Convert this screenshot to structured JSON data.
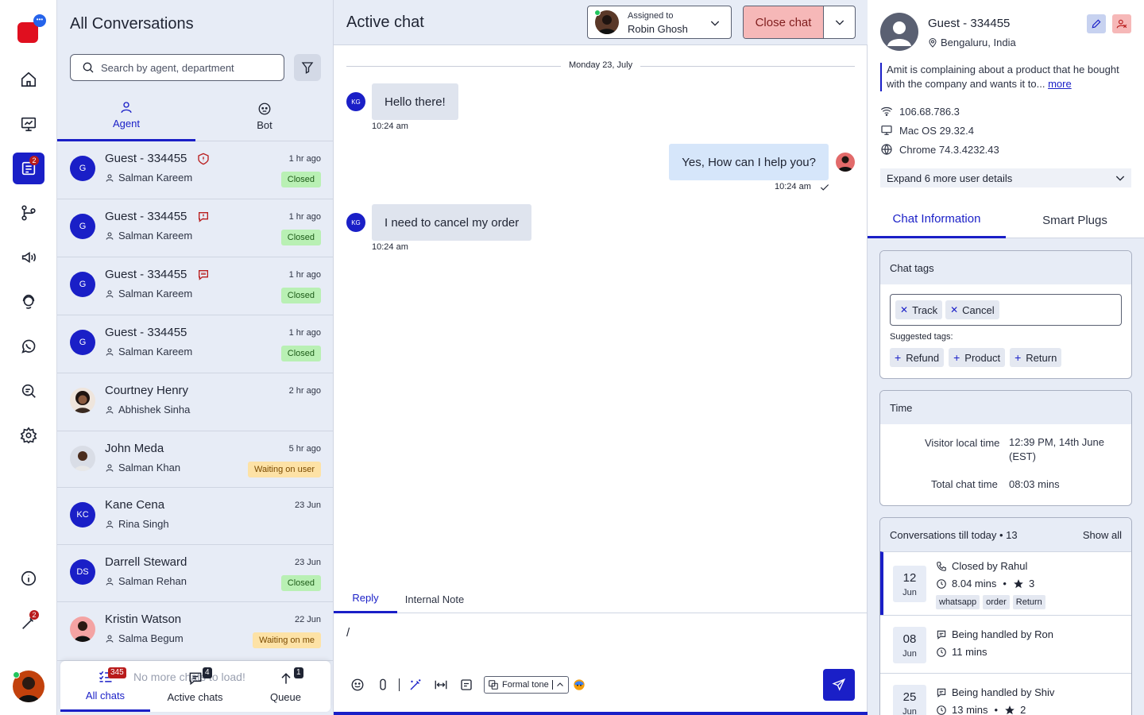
{
  "colors": {
    "accent": "#1a1fc7",
    "closed_bg": "#b9f0b4",
    "waiting_bg": "#fde2a6",
    "danger_bg": "#f6b8b8"
  },
  "rail": {
    "inbox_badge": "2",
    "magic_badge": "2"
  },
  "list": {
    "title": "All Conversations",
    "search_placeholder": "Search by agent, department",
    "tabs": [
      {
        "label": "Agent"
      },
      {
        "label": "Bot"
      }
    ],
    "items": [
      {
        "initials": "G",
        "name": "Guest - 334455",
        "agent": "Salman Kareem",
        "time": "1 hr ago",
        "status": "Closed"
      },
      {
        "initials": "G",
        "name": "Guest - 334455",
        "agent": "Salman Kareem",
        "time": "1 hr ago",
        "status": "Closed"
      },
      {
        "initials": "G",
        "name": "Guest - 334455",
        "agent": "Salman Kareem",
        "time": "1 hr ago",
        "status": "Closed"
      },
      {
        "initials": "G",
        "name": "Guest - 334455",
        "agent": "Salman Kareem",
        "time": "1 hr ago",
        "status": "Closed"
      },
      {
        "initials": "",
        "name": "Courtney Henry",
        "agent": "Abhishek Sinha",
        "time": "2 hr ago",
        "status": ""
      },
      {
        "initials": "",
        "name": "John Meda",
        "agent": "Salman Khan",
        "time": "5 hr ago",
        "status": "Waiting on user"
      },
      {
        "initials": "KC",
        "name": "Kane Cena",
        "agent": "Rina Singh",
        "time": "23 Jun",
        "status": ""
      },
      {
        "initials": "DS",
        "name": "Darrell Steward",
        "agent": "Salman Rehan",
        "time": "23 Jun",
        "status": "Closed"
      },
      {
        "initials": "",
        "name": "Kristin Watson",
        "agent": "Salma Begum",
        "time": "22 Jun",
        "status": "Waiting on me"
      }
    ],
    "load_more": "No more chats to load!",
    "bottom_nav": [
      {
        "label": "All chats",
        "badge": "345"
      },
      {
        "label": "Active chats",
        "badge": "4"
      },
      {
        "label": "Queue",
        "badge": "1"
      }
    ]
  },
  "chat": {
    "title": "Active chat",
    "assigned_label": "Assigned to",
    "assigned_name": "Robin Ghosh",
    "close_label": "Close chat",
    "date": "Monday 23, July",
    "messages": [
      {
        "from": "KG",
        "text": "Hello there!",
        "time": "10:24 am"
      },
      {
        "from": "agent",
        "text": "Yes, How can I help you?",
        "time": "10:24 am"
      },
      {
        "from": "KG",
        "text": "I need to cancel my order",
        "time": "10:24 am"
      }
    ],
    "reply_tabs": [
      {
        "label": "Reply"
      },
      {
        "label": "Internal Note"
      }
    ],
    "composer_value": "/",
    "tone_label": "Formal tone"
  },
  "details": {
    "name": "Guest - 334455",
    "location": "Bengaluru, India",
    "description": "Amit is complaining about a product that he bought with the company and wants it to...",
    "more": "more",
    "ip": "106.68.786.3",
    "os": "Mac OS 29.32.4",
    "browser": "Chrome 74.3.4232.43",
    "expand_label": "Expand 6 more user details",
    "tabs": [
      {
        "label": "Chat Information"
      },
      {
        "label": "Smart Plugs"
      }
    ],
    "chat_tags": {
      "title": "Chat tags",
      "tags": [
        "Track",
        "Cancel"
      ],
      "suggested_label": "Suggested tags:",
      "suggested": [
        "Refund",
        "Product",
        "Return"
      ]
    },
    "time": {
      "title": "Time",
      "visitor_label": "Visitor local time",
      "visitor_value": "12:39 PM, 14th June (EST)",
      "total_label": "Total chat time",
      "total_value": "08:03 mins"
    },
    "conversations": {
      "title": "Conversations till today • 13",
      "show_all": "Show all",
      "items": [
        {
          "day": "12",
          "month": "Jun",
          "status": "Closed by Rahul",
          "duration": "8.04 mins",
          "rating": "3",
          "tags": [
            "whatsapp",
            "order",
            "Return"
          ]
        },
        {
          "day": "08",
          "month": "Jun",
          "status": "Being handled by Ron",
          "duration": "11 mins",
          "rating": "",
          "tags": []
        },
        {
          "day": "25",
          "month": "Jun",
          "status": "Being handled by Shiv",
          "duration": "13 mins",
          "rating": "2",
          "tags": []
        }
      ]
    }
  }
}
